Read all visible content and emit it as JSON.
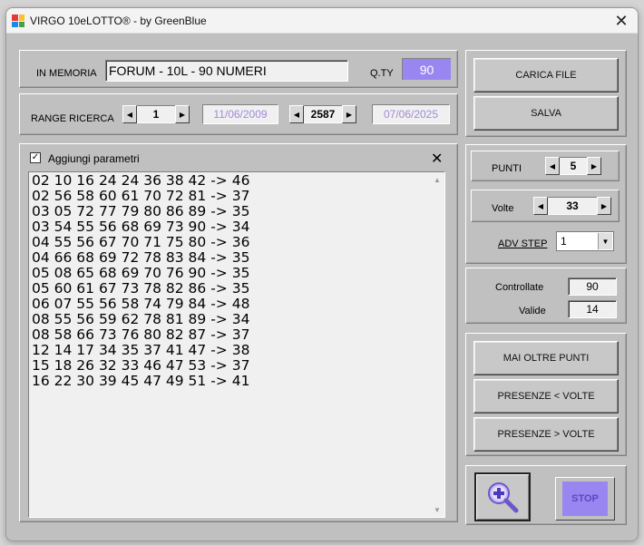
{
  "window": {
    "title": "VIRGO 10eLOTTO® - by GreenBlue",
    "close_glyph": "✕"
  },
  "memory": {
    "label": "IN MEMORIA",
    "value": "FORUM - 10L - 90 NUMERI",
    "qty_label": "Q.TY",
    "qty_value": "90",
    "qty_color": "#9a86f0"
  },
  "range": {
    "label": "RANGE RICERCA",
    "from_index": "1",
    "from_date": "11/06/2009",
    "to_index": "2587",
    "to_date": "07/06/2025"
  },
  "files": {
    "load_label": "CARICA FILE",
    "save_label": "SALVA"
  },
  "results": {
    "checkbox_label": "Aggiungi parametri",
    "checked": true,
    "clear_glyph": "✕",
    "lines": [
      "02 10 16 24 24 36 38 42 -> 46",
      "02 56 58 60 61 70 72 81 -> 37",
      "03 05 72 77 79 80 86 89 -> 35",
      "03 54 55 56 68 69 73 90 -> 34",
      "04 55 56 67 70 71 75 80 -> 36",
      "04 66 68 69 72 78 83 84 -> 35",
      "05 08 65 68 69 70 76 90 -> 35",
      "05 60 61 67 73 78 82 86 -> 35",
      "06 07 55 56 58 74 79 84 -> 48",
      "08 55 56 59 62 78 81 89 -> 34",
      "08 58 66 73 76 80 82 87 -> 37",
      "12 14 17 34 35 37 41 47 -> 38",
      "15 18 26 32 33 46 47 53 -> 37",
      "16 22 30 39 45 47 49 51 -> 41"
    ]
  },
  "params": {
    "punti_label": "PUNTI",
    "punti_value": "5",
    "volte_label": "Volte",
    "volte_value": "33",
    "adv_step_label": "ADV STEP",
    "adv_step_value": "1"
  },
  "stats": {
    "controllate_label": "Controllate",
    "controllate_value": "90",
    "valide_label": "Valide",
    "valide_value": "14"
  },
  "actions": {
    "mai_oltre_label": "MAI OLTRE PUNTI",
    "presenze_lt_label": "PRESENZE < VOLTE",
    "presenze_gt_label": "PRESENZE > VOLTE",
    "stop_label": "STOP",
    "stop_color": "#9a86f0"
  }
}
